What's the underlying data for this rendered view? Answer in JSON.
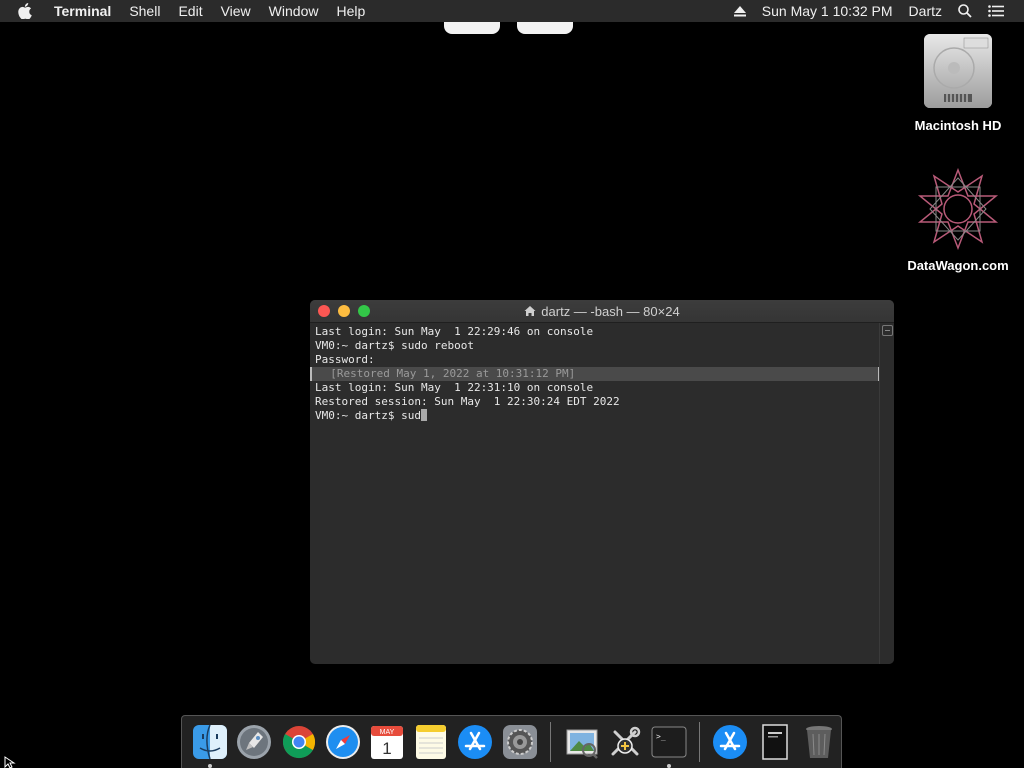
{
  "menubar": {
    "app_name": "Terminal",
    "items": [
      "Shell",
      "Edit",
      "View",
      "Window",
      "Help"
    ],
    "datetime": "Sun May 1  10:32 PM",
    "user": "Dartz"
  },
  "desktop": {
    "icons": [
      {
        "label": "Macintosh HD",
        "icon": "hard-drive-icon"
      },
      {
        "label": "DataWagon.com",
        "icon": "geometric-star-icon"
      }
    ]
  },
  "terminal": {
    "title": "dartz — -bash — 80×24",
    "lines": [
      "Last login: Sun May  1 22:29:46 on console",
      "VM0:~ dartz$ sudo reboot",
      "Password:",
      "  [Restored May 1, 2022 at 10:31:12 PM]",
      "Last login: Sun May  1 22:31:10 on console",
      "Restored session: Sun May  1 22:30:24 EDT 2022",
      "VM0:~ dartz$ sud"
    ]
  },
  "dock": {
    "apps": [
      "finder-icon",
      "launchpad-icon",
      "chrome-icon",
      "safari-icon",
      "calendar-icon",
      "notes-icon",
      "app-store-icon",
      "system-preferences-icon",
      "preview-icon",
      "utilities-icon",
      "terminal-icon",
      "app-store-downloads-icon",
      "document-icon",
      "trash-icon"
    ],
    "calendar_month": "MAY",
    "calendar_day": "1",
    "terminal_prompt": ">_"
  },
  "colors": {
    "close": "#fc5753",
    "minimize": "#fdbc40",
    "maximize": "#33c748"
  }
}
